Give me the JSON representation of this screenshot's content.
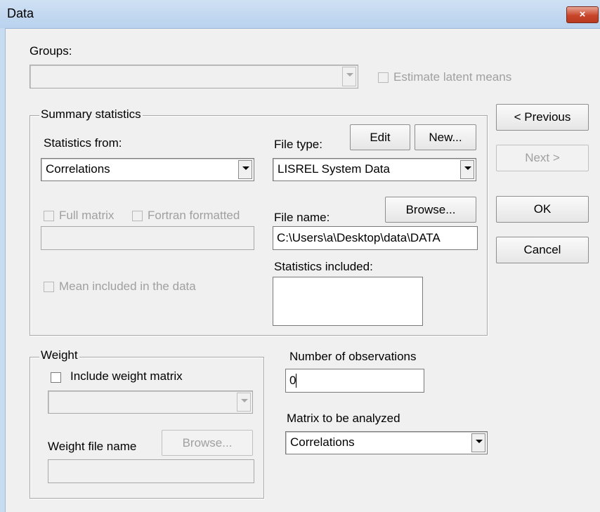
{
  "window": {
    "title": "Data",
    "close_glyph": "×"
  },
  "groups": {
    "label": "Groups:",
    "value": "",
    "estimate_latent_means": "Estimate latent means"
  },
  "summary": {
    "legend": "Summary statistics",
    "statistics_from_label": "Statistics from:",
    "statistics_from_value": "Correlations",
    "file_type_label": "File type:",
    "edit_button": "Edit",
    "new_button": "New...",
    "file_type_value": "LISREL System Data",
    "full_matrix": "Full matrix",
    "fortran_formatted": "Fortran formatted",
    "file_name_label": "File name:",
    "browse_button": "Browse...",
    "file_name_value": "C:\\Users\\a\\Desktop\\data\\DATA",
    "statistics_included_label": "Statistics included:",
    "mean_included": "Mean included in the data"
  },
  "side_buttons": {
    "previous": "< Previous",
    "next": "Next >",
    "ok": "OK",
    "cancel": "Cancel"
  },
  "weight": {
    "legend": "Weight",
    "include_weight_matrix": "Include weight matrix",
    "weight_file_name_label": "Weight file name",
    "browse_button": "Browse..."
  },
  "observations": {
    "label": "Number of observations",
    "value": "0"
  },
  "matrix": {
    "label": "Matrix to be analyzed",
    "value": "Correlations"
  }
}
